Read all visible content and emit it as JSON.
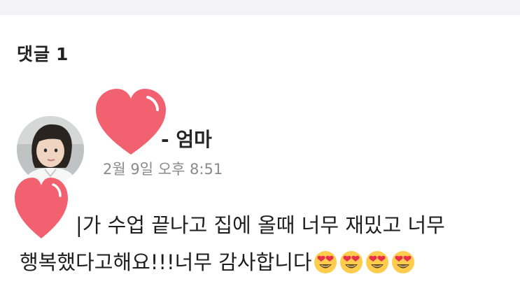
{
  "comments": {
    "heading": "댓글",
    "count": "1"
  },
  "comment": {
    "author_suffix": "- 엄마",
    "timestamp": "2월 9일 오후 8:51",
    "line1": "|가 수업 끝나고 집에 올때 너무 재밌고 너무",
    "line2": "행복했다고해요!!!너무 감사합니다",
    "emoji": "heart-eyes-emoji",
    "emoji_count": 4
  },
  "stickers": {
    "icon": "pink-heart-sticker",
    "color": "#f2616f",
    "highlight": "#ffffff"
  },
  "colors": {
    "top_bar": "#f4f4f6",
    "heading_text": "#222222",
    "author_text": "#262626",
    "timestamp_text": "#8a8a8a",
    "body_text": "#1e1e1e",
    "emoji_face": "#ffcc4d",
    "emoji_heart": "#e8304a"
  }
}
